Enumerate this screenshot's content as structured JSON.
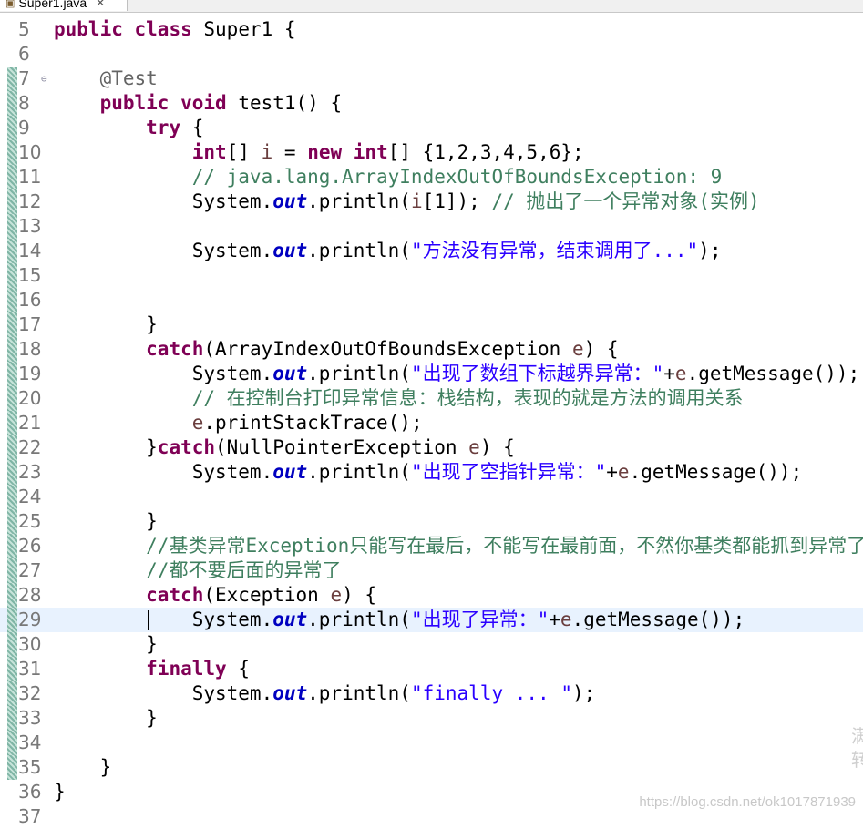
{
  "tab": {
    "title": "Super1.java"
  },
  "watermark": "https://blog.csdn.net/ok1017871939",
  "side_mark": [
    "满",
    "转"
  ],
  "lines": [
    {
      "n": "5",
      "tokens": [
        [
          "kw",
          "public"
        ],
        [
          "",
          "  "
        ],
        [
          "kw",
          "class"
        ],
        [
          "",
          ""
        ],
        [
          "",
          "Super1 {"
        ]
      ]
    },
    {
      "n": "6",
      "tokens": []
    },
    {
      "n": "7",
      "fold": true,
      "tokens": [
        [
          "",
          "    "
        ],
        [
          "ann",
          "@Test"
        ]
      ]
    },
    {
      "n": "8",
      "tokens": [
        [
          "",
          "    "
        ],
        [
          "kw",
          "public"
        ],
        [
          "",
          ""
        ],
        [
          "kw",
          "void"
        ],
        [
          "",
          ""
        ],
        [
          "",
          "test1() {"
        ]
      ]
    },
    {
      "n": "9",
      "tokens": [
        [
          "",
          "        "
        ],
        [
          "kw",
          "try"
        ],
        [
          "",
          "{"
        ]
      ]
    },
    {
      "n": "10",
      "tokens": [
        [
          "",
          "            "
        ],
        [
          "kw",
          "int"
        ],
        [
          "",
          "[] "
        ],
        [
          "var",
          "i"
        ],
        [
          "",
          "="
        ],
        [
          "kw",
          "new"
        ],
        [
          "",
          ""
        ],
        [
          "kw",
          "int"
        ],
        [
          "",
          "[] {1,2,3,4,5,6};"
        ]
      ]
    },
    {
      "n": "11",
      "tokens": [
        [
          "",
          "            "
        ],
        [
          "cm",
          "// java.lang.ArrayIndexOutOfBoundsException: 9"
        ]
      ]
    },
    {
      "n": "12",
      "tokens": [
        [
          "",
          "            System."
        ],
        [
          "fld",
          "out"
        ],
        [
          "",
          ".println("
        ],
        [
          "var",
          "i"
        ],
        [
          "",
          "[1]); "
        ],
        [
          "cm",
          "// 抛出了一个异常对象(实例)"
        ]
      ]
    },
    {
      "n": "13",
      "tokens": []
    },
    {
      "n": "14",
      "tokens": [
        [
          "",
          "            System."
        ],
        [
          "fld",
          "out"
        ],
        [
          "",
          ".println("
        ],
        [
          "str",
          "\"方法没有异常，结束调用了...\""
        ],
        [
          "",
          ");"
        ]
      ]
    },
    {
      "n": "15",
      "tokens": []
    },
    {
      "n": "16",
      "tokens": []
    },
    {
      "n": "17",
      "tokens": [
        [
          "",
          "        }"
        ]
      ]
    },
    {
      "n": "18",
      "tokens": [
        [
          "",
          "        "
        ],
        [
          "kw",
          "catch"
        ],
        [
          "",
          "(ArrayIndexOutOfBoundsException "
        ],
        [
          "var",
          "e"
        ],
        [
          "",
          ") {"
        ]
      ]
    },
    {
      "n": "19",
      "tokens": [
        [
          "",
          "            System."
        ],
        [
          "fld",
          "out"
        ],
        [
          "",
          ".println("
        ],
        [
          "str",
          "\"出现了数组下标越界异常：\""
        ],
        [
          "",
          "+"
        ],
        [
          "var",
          "e"
        ],
        [
          "",
          ".getMessage());"
        ]
      ]
    },
    {
      "n": "20",
      "tokens": [
        [
          "",
          "            "
        ],
        [
          "cm",
          "// 在控制台打印异常信息：栈结构，表现的就是方法的调用关系"
        ]
      ]
    },
    {
      "n": "21",
      "tokens": [
        [
          "",
          "            "
        ],
        [
          "var",
          "e"
        ],
        [
          "",
          ".printStackTrace();"
        ]
      ]
    },
    {
      "n": "22",
      "tokens": [
        [
          "",
          "        }"
        ],
        [
          "kw",
          "catch"
        ],
        [
          "",
          "(NullPointerException "
        ],
        [
          "var",
          "e"
        ],
        [
          "",
          ") {"
        ]
      ]
    },
    {
      "n": "23",
      "tokens": [
        [
          "",
          "            System."
        ],
        [
          "fld",
          "out"
        ],
        [
          "",
          ".println("
        ],
        [
          "str",
          "\"出现了空指针异常：\""
        ],
        [
          "",
          "+"
        ],
        [
          "var",
          "e"
        ],
        [
          "",
          ".getMessage());"
        ]
      ]
    },
    {
      "n": "24",
      "tokens": []
    },
    {
      "n": "25",
      "tokens": [
        [
          "",
          "        }"
        ]
      ]
    },
    {
      "n": "26",
      "tokens": [
        [
          "",
          "        "
        ],
        [
          "cm",
          "//基类异常Exception只能写在最后，不能写在最前面，不然你基类都能抓到异常了。"
        ]
      ]
    },
    {
      "n": "27",
      "tokens": [
        [
          "",
          "        "
        ],
        [
          "cm",
          "//都不要后面的异常了"
        ]
      ]
    },
    {
      "n": "28",
      "tokens": [
        [
          "",
          "        "
        ],
        [
          "kw",
          "catch"
        ],
        [
          "",
          "(Exception "
        ],
        [
          "var",
          "e"
        ],
        [
          "",
          ") {"
        ]
      ]
    },
    {
      "n": "29",
      "current": true,
      "tokens": [
        [
          "",
          "            System."
        ],
        [
          "fld",
          "out"
        ],
        [
          "",
          ".println("
        ],
        [
          "str",
          "\"出现了异常：\""
        ],
        [
          "",
          "+"
        ],
        [
          "var",
          "e"
        ],
        [
          "",
          ".getMessage());"
        ]
      ]
    },
    {
      "n": "30",
      "tokens": [
        [
          "",
          "        }"
        ]
      ]
    },
    {
      "n": "31",
      "tokens": [
        [
          "",
          "        "
        ],
        [
          "kw",
          "finally"
        ],
        [
          "",
          "{"
        ]
      ]
    },
    {
      "n": "32",
      "tokens": [
        [
          "",
          "            System."
        ],
        [
          "fld",
          "out"
        ],
        [
          "",
          ".println("
        ],
        [
          "str",
          "\"finally ... \""
        ],
        [
          "",
          ");"
        ]
      ]
    },
    {
      "n": "33",
      "tokens": [
        [
          "",
          "        }"
        ]
      ]
    },
    {
      "n": "34",
      "tokens": []
    },
    {
      "n": "35",
      "tokens": [
        [
          "",
          "    }"
        ]
      ]
    },
    {
      "n": "36",
      "tokens": [
        [
          "",
          "}"
        ]
      ]
    },
    {
      "n": "37",
      "tokens": []
    }
  ]
}
